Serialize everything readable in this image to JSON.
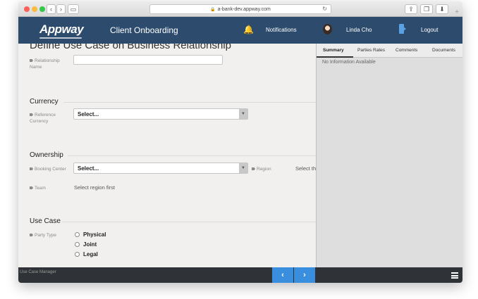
{
  "browser": {
    "url": "a-bank-dev.appway.com",
    "back_icon": "chevron-left-icon",
    "forward_icon": "chevron-right-icon"
  },
  "header": {
    "logo": "Appway",
    "title": "Client Onboarding",
    "notifications": "Notifications",
    "user_name": "Linda Cho",
    "logout": "Logout"
  },
  "form": {
    "page_title": "Define Use Case on Business Relationship",
    "relationship_name_label": "Relationship Name",
    "currency": {
      "heading": "Currency",
      "reference_currency_label": "Reference Currency",
      "reference_currency_value": "Select..."
    },
    "ownership": {
      "heading": "Ownership",
      "booking_center_label": "Booking Center",
      "booking_center_value": "Select...",
      "region_label": "Region",
      "region_value": "Select th",
      "team_label": "Team",
      "team_value": "Select region first"
    },
    "use_case": {
      "heading": "Use Case",
      "party_type_label": "Party Type",
      "options": [
        "Physical",
        "Joint",
        "Legal"
      ]
    }
  },
  "panel": {
    "tabs": [
      "Summary",
      "Parties Rates",
      "Comments",
      "Documents"
    ],
    "active_tab": "Summary",
    "empty_text": "No Information Available"
  },
  "footer": {
    "label": "Use Case Manager",
    "prev": "‹",
    "next": "›"
  },
  "colors": {
    "header_bg": "#2d4c6d",
    "accent": "#3a8ede",
    "footer_bg": "#2f3236"
  }
}
